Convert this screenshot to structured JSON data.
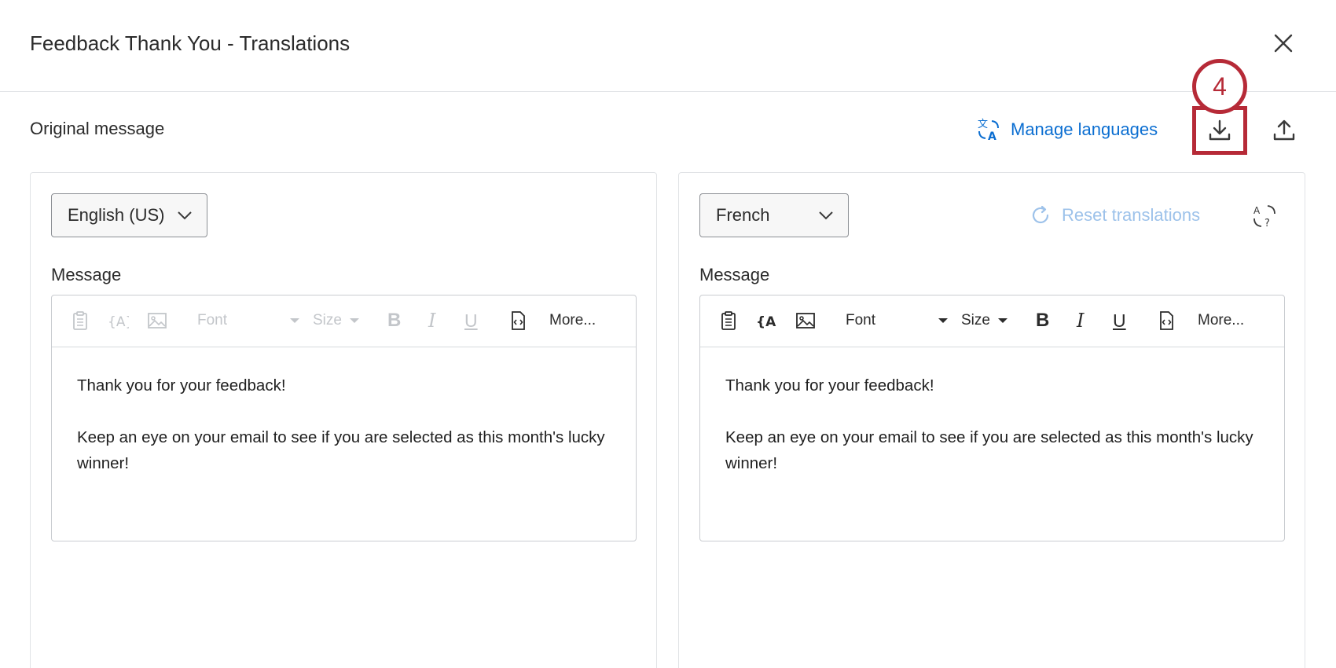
{
  "header": {
    "title": "Feedback Thank You - Translations"
  },
  "subheader": {
    "label": "Original message",
    "manage_languages": "Manage languages",
    "step_number": "4"
  },
  "colors": {
    "accent": "#0b6ed1",
    "highlight": "#b62a37",
    "disabled": "#c3c6ca"
  },
  "left_panel": {
    "language": "English (US)",
    "message_label": "Message",
    "toolbar": {
      "font": "Font",
      "size": "Size",
      "bold": "B",
      "italic": "I",
      "underline": "U",
      "more": "More..."
    },
    "body": {
      "line1": "Thank you for your feedback!",
      "line2": "Keep an eye on your email to see if you are selected as this month's lucky winner!"
    }
  },
  "right_panel": {
    "language": "French",
    "reset_label": "Reset translations",
    "message_label": "Message",
    "toolbar": {
      "font": "Font",
      "size": "Size",
      "bold": "B",
      "italic": "I",
      "underline": "U",
      "more": "More..."
    },
    "body": {
      "line1": "Thank you for your feedback!",
      "line2": "Keep an eye on your email to see if you are selected as this month's lucky winner!"
    }
  }
}
